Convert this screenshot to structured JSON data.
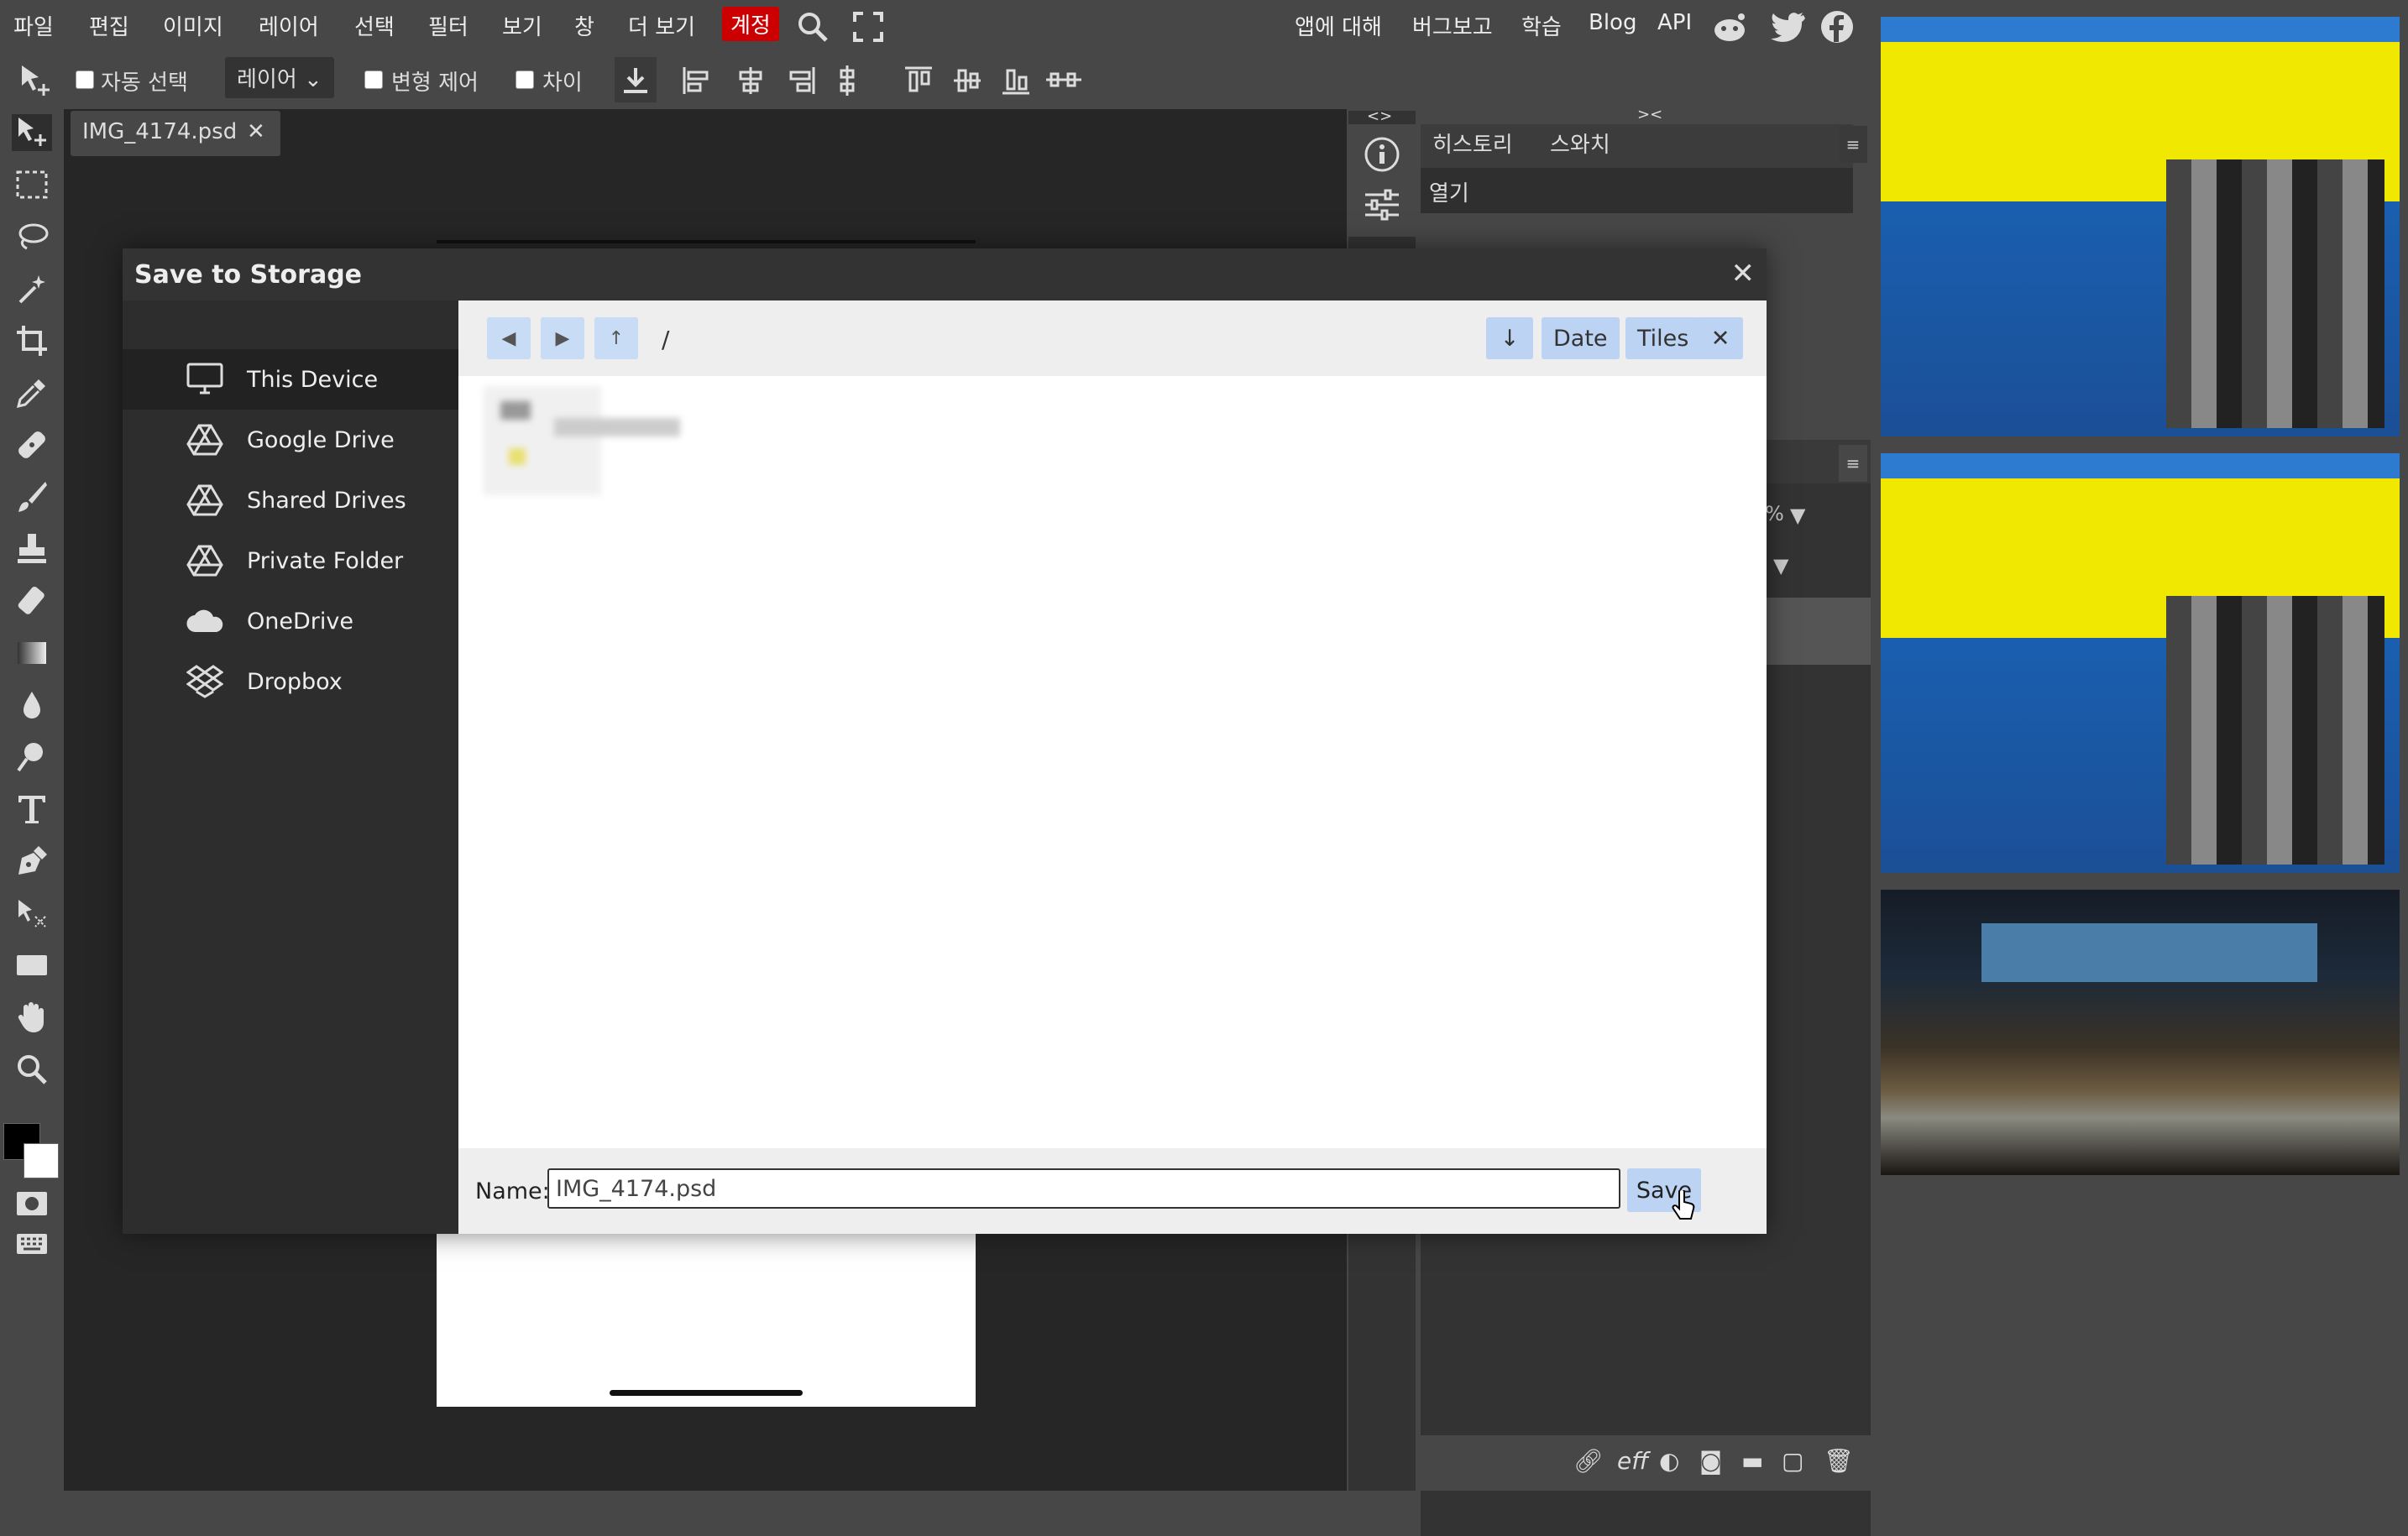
{
  "menu": {
    "items": [
      "파일",
      "편집",
      "이미지",
      "레이어",
      "선택",
      "필터",
      "보기",
      "창",
      "더 보기"
    ],
    "account": "계정",
    "right_items": [
      "앱에 대해",
      "버그보고",
      "학습",
      "Blog",
      "API"
    ],
    "social_icons": [
      "reddit-icon",
      "twitter-icon",
      "facebook-icon"
    ]
  },
  "options": {
    "auto_select": "자동 선택",
    "layer_select": "레이어",
    "transform_controls": "변형 제어",
    "distances": "차이"
  },
  "document_tab": {
    "name": "IMG_4174.psd",
    "close": "✕"
  },
  "panels": {
    "toggle_left": "<>",
    "toggle_right": "><",
    "history_tab": "히스토리",
    "swatches_tab": "스와치",
    "history_entry": "열기",
    "layer_menu": "≡",
    "opacity_suffix": "%"
  },
  "dialog": {
    "title": "Save to Storage",
    "close": "✕",
    "locations": [
      {
        "label": "This Device",
        "icon": "monitor-icon"
      },
      {
        "label": "Google Drive",
        "icon": "google-drive-icon"
      },
      {
        "label": "Shared Drives",
        "icon": "google-drive-icon"
      },
      {
        "label": "Private Folder",
        "icon": "google-drive-icon"
      },
      {
        "label": "OneDrive",
        "icon": "onedrive-icon"
      },
      {
        "label": "Dropbox",
        "icon": "dropbox-icon"
      }
    ],
    "path": "/",
    "sort_label": "Date",
    "view_label": "Tiles",
    "name_label": "Name:",
    "name_value": "IMG_4174.psd",
    "save_label": "Save"
  },
  "colors": {
    "account_red": "#cc0000",
    "dialog_button_blue": "#bcd3f3",
    "app_gray": "#474747",
    "canvas_dark": "#262626"
  }
}
